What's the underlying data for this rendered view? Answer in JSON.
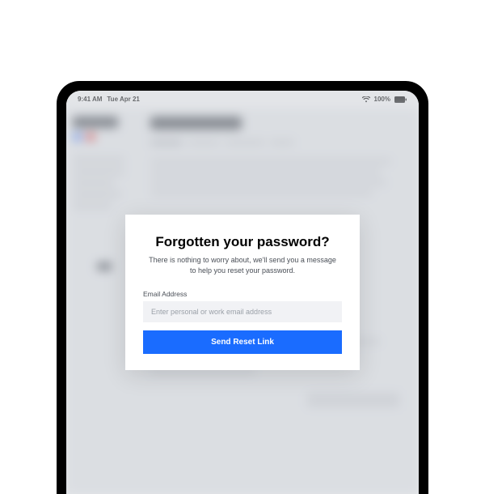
{
  "statusbar": {
    "time": "9:41 AM",
    "date": "Tue Apr 21",
    "battery": "100%"
  },
  "modal": {
    "title": "Forgotten your password?",
    "subtitle": "There is nothing to worry about, we'll send you a message to help you reset your password.",
    "emailLabel": "Email Address",
    "emailPlaceholder": "Enter personal or work email address",
    "buttonLabel": "Send Reset Link"
  }
}
